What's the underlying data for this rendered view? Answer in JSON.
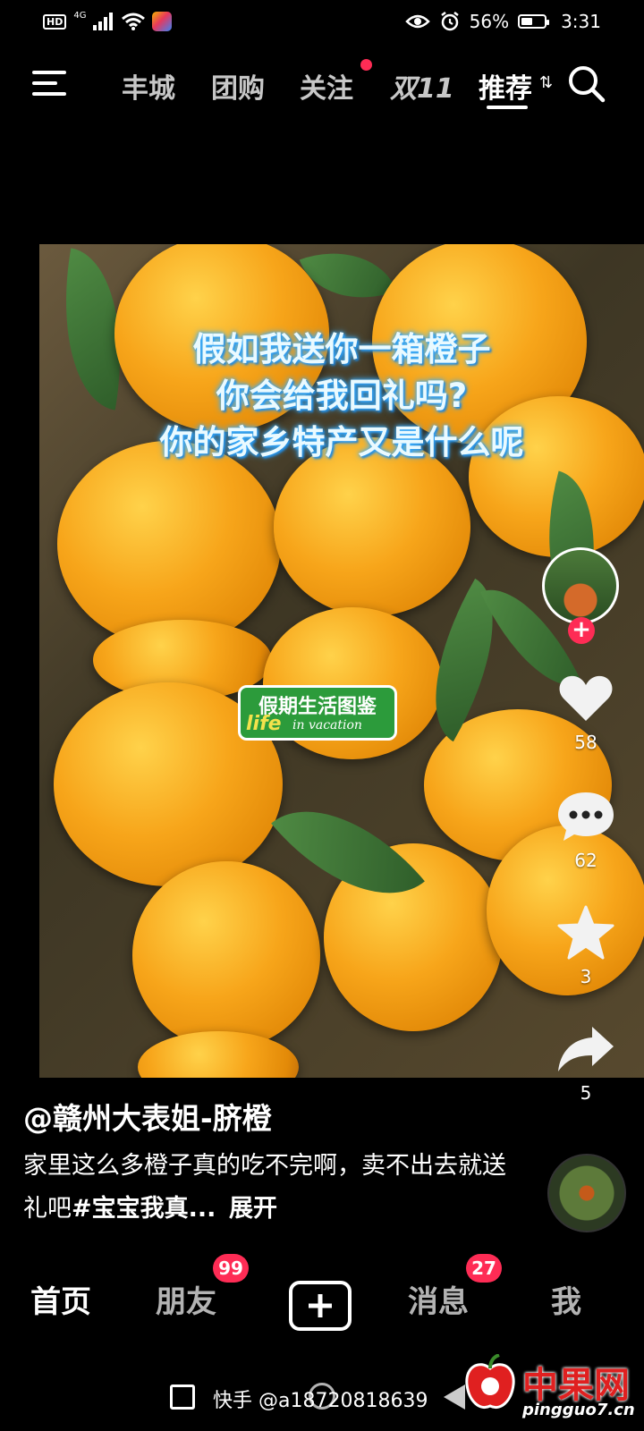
{
  "status_bar": {
    "hd": "HD",
    "network": "4G",
    "battery_percent": "56%",
    "battery_level": 0.56,
    "time": "3:31"
  },
  "top_tabs": [
    {
      "label": "丰城",
      "active": false
    },
    {
      "label": "团购",
      "active": false
    },
    {
      "label": "关注",
      "active": false,
      "has_dot": true
    },
    {
      "label": "双11",
      "active": false
    },
    {
      "label": "推荐",
      "active": true
    }
  ],
  "video": {
    "overlay_lines": [
      "假如我送你一箱橙子",
      "你会给我回礼吗?",
      "你的家乡特产又是什么呢"
    ],
    "watermark_cn": "假期生活图鉴",
    "watermark_life": "life",
    "watermark_vacation": "in vacation"
  },
  "rail": {
    "likes": "58",
    "comments": "62",
    "favorites": "3",
    "shares": "5"
  },
  "caption": {
    "author": "@赣州大表姐-脐橙",
    "text": "家里这么多橙子真的吃不完啊，卖不出去就送礼吧",
    "hashtag": "#宝宝我真...",
    "expand": "展开"
  },
  "bottom_nav": {
    "home": "首页",
    "friends": "朋友",
    "friends_badge": "99",
    "messages": "消息",
    "messages_badge": "27",
    "me": "我"
  },
  "footer": {
    "kuaishou_handle": "快手 @a18720818639",
    "site_name": "中果网",
    "site_url": "pingguo7.cn"
  },
  "colors": {
    "accent": "#fe2c55",
    "background": "#000000"
  }
}
